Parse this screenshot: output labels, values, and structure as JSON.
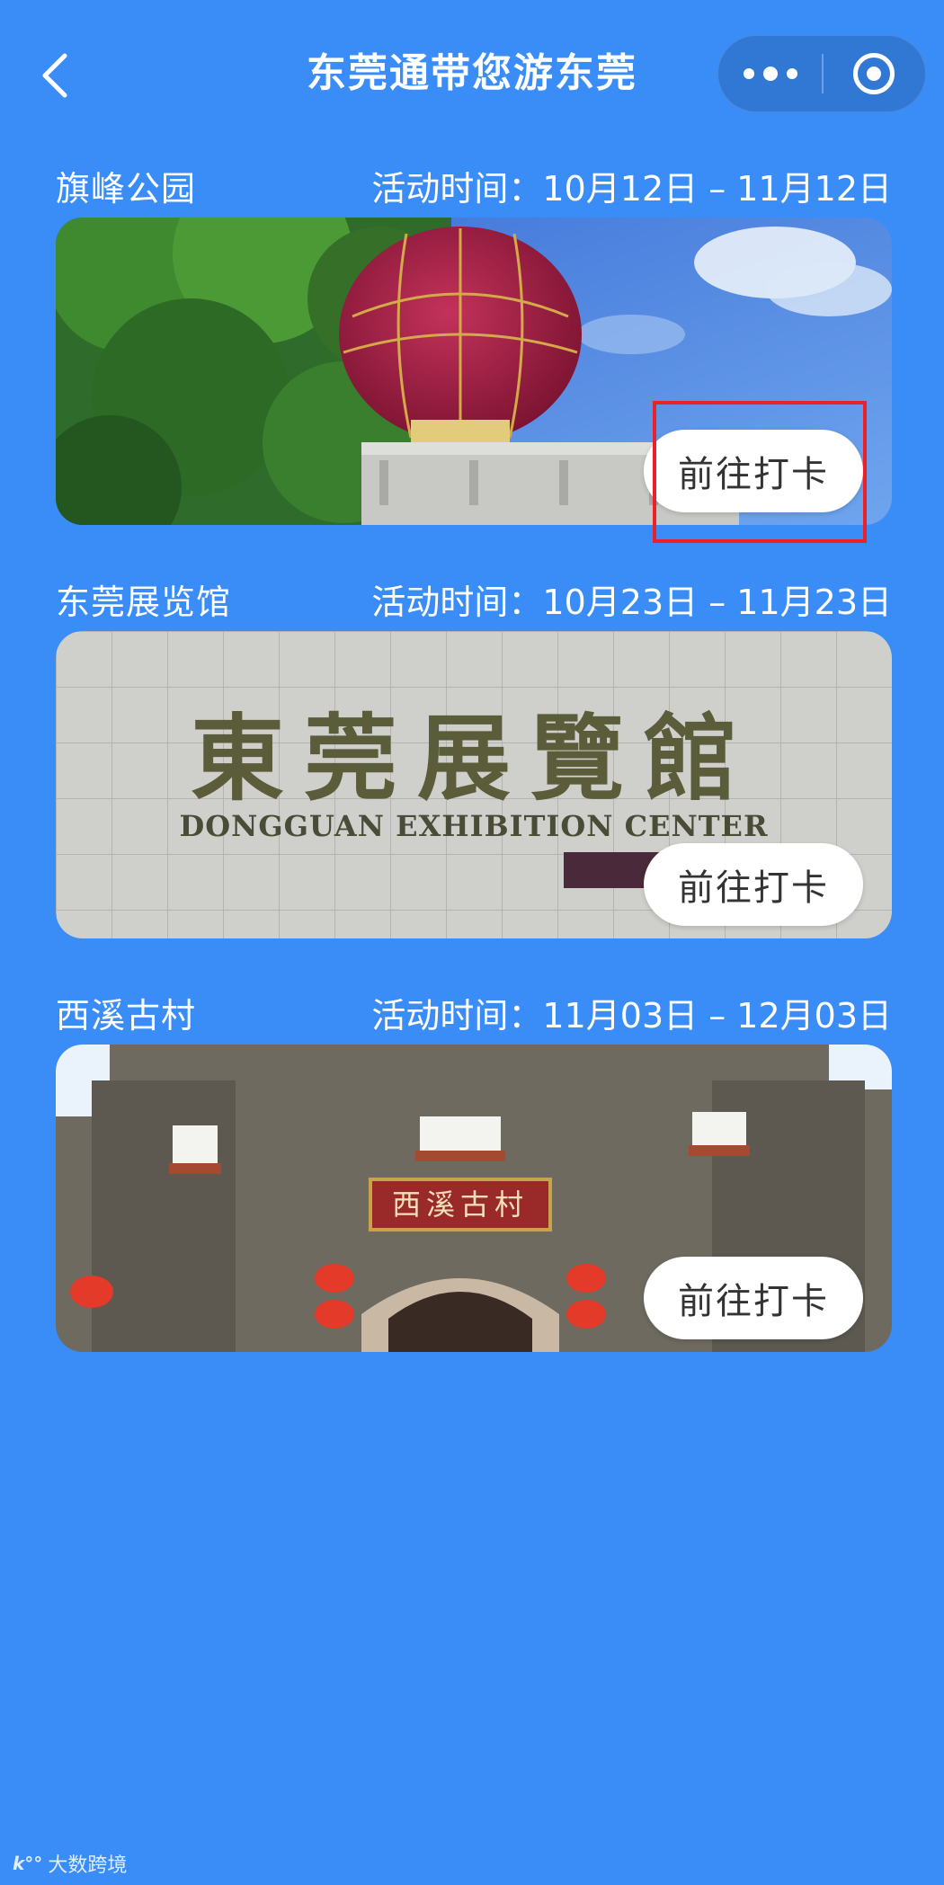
{
  "nav": {
    "title": "东莞通带您游东莞"
  },
  "cards": [
    {
      "name": "旗峰公园",
      "date": "活动时间：10月12日 – 11月12日",
      "button": "前往打卡"
    },
    {
      "name": "东莞展览馆",
      "date": "活动时间：10月23日 – 11月23日",
      "button": "前往打卡",
      "sign_cn": "東莞展覽館",
      "sign_en": "DONGGUAN EXHIBITION CENTER"
    },
    {
      "name": "西溪古村",
      "date": "活动时间：11月03日 – 12月03日",
      "button": "前往打卡",
      "plaque": "西溪古村"
    }
  ],
  "watermark": {
    "text": "大数跨境"
  },
  "colors": {
    "background": "#3a8cf7",
    "highlight": "#e8212b",
    "button_bg": "#ffffff"
  }
}
